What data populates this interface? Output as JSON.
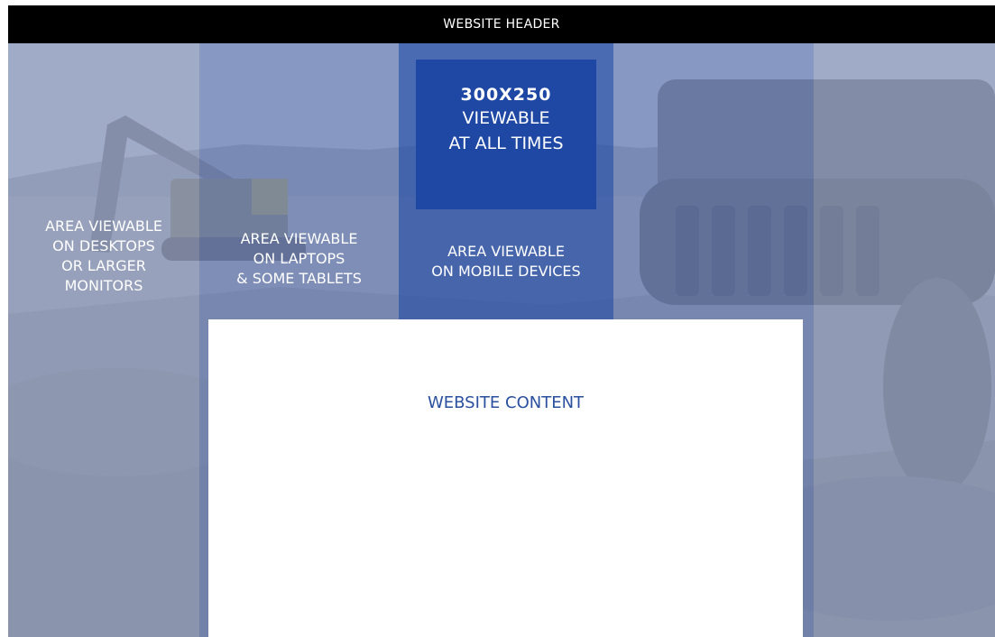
{
  "header": {
    "label": "WEBSITE HEADER"
  },
  "ad_box": {
    "size_label": "300X250",
    "lines": [
      "VIEWABLE",
      "AT ALL TIMES"
    ]
  },
  "areas": {
    "desktop": [
      "AREA VIEWABLE",
      "ON DESKTOPS",
      "OR LARGER",
      "MONITORS"
    ],
    "laptop": [
      "AREA VIEWABLE",
      "ON LAPTOPS",
      "& SOME TABLETS"
    ],
    "mobile": [
      "AREA VIEWABLE",
      "ON MOBILE DEVICES"
    ]
  },
  "content": {
    "label": "WEBSITE CONTENT"
  },
  "colors": {
    "header_bg": "#000000",
    "ad_box": "#1f48a4",
    "mobile_band": "#2e54aa",
    "laptop_band": "#6880be",
    "desktop_band": "#96a3c7",
    "content_text": "#2a4f9f"
  }
}
